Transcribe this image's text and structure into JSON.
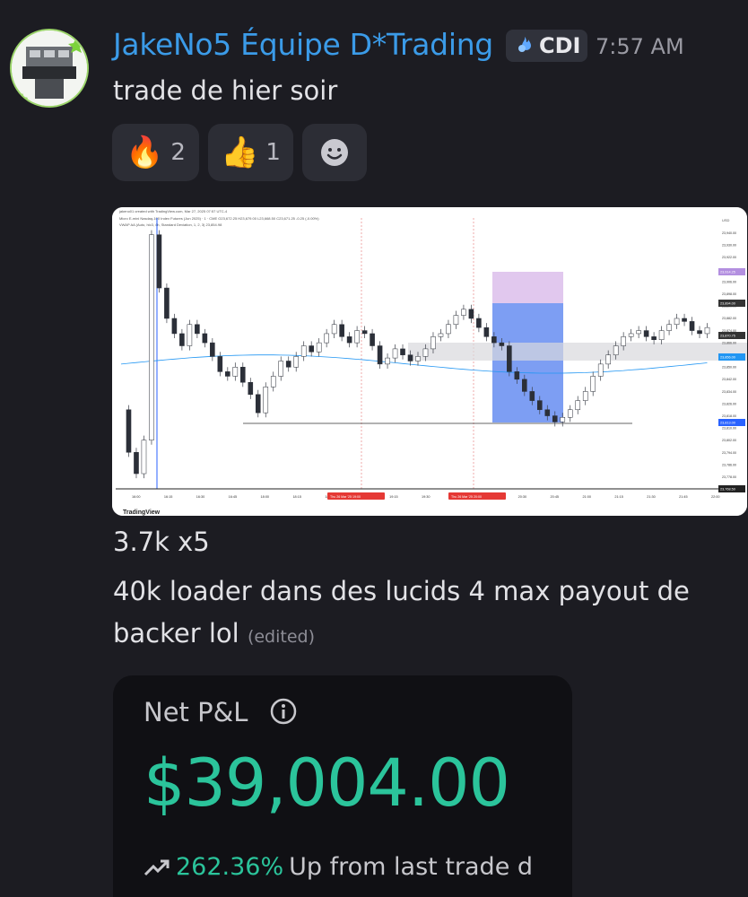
{
  "message": {
    "username": "JakeNo5 Équipe D*Trading",
    "tag": "CDI",
    "timestamp": "7:57 AM",
    "line1": "trade de hier soir",
    "line2": "3.7k x5",
    "line3": "40k loader dans des lucids 4 max payout de",
    "line4": "backer lol",
    "edited": "(edited)"
  },
  "reactions": [
    {
      "emoji": "🔥",
      "count": "2"
    },
    {
      "emoji": "👍",
      "count": "1"
    }
  ],
  "chart": {
    "header1": "jakeno01 created with TradingView.com, Mar 27, 2025 07:57 UTC-4",
    "header2": "Micro E-mini Nasdaq-100 Index Futures (Jun 2025) · 1 · CME  O23,672.25 H23,679.00 L23,668.50 C23,671.25 -0.25 (-0.00%)",
    "header3": "VWAP AA (Auto, hlc3, 4h, Standard Deviation, 1, 2, 3)  23,854.98",
    "currency": "USD",
    "watermark": "TradingView",
    "date_badge_1": "Thu 26 Mar '25  19:00",
    "date_badge_2": "Thu 26 Mar '25  20:00",
    "price_badges": {
      "top": "23,914.25",
      "entry": "23,894.00",
      "mid": "23,870.75",
      "vwap": "23,856.00",
      "target": "23,813.00",
      "last": "23,768.50"
    }
  },
  "chart_data": {
    "type": "candlestick",
    "x_ticks": [
      "16:00",
      "16:15",
      "16:30",
      "16:45",
      "18:00",
      "18:15",
      "18:30",
      "18:45",
      "19:15",
      "19:30",
      "19:45",
      "20:15",
      "20:30",
      "20:45",
      "21:00",
      "21:15",
      "21:30",
      "21:45",
      "22:00"
    ],
    "y_ticks": [
      "23,940.00",
      "23,930.00",
      "23,922.00",
      "23,914.00",
      "23,906.00",
      "23,898.00",
      "23,890.00",
      "23,882.00",
      "23,874.00",
      "23,866.00",
      "23,858.00",
      "23,850.00",
      "23,842.00",
      "23,834.00",
      "23,826.00",
      "23,818.00",
      "23,810.00",
      "23,802.00",
      "23,794.00",
      "23,786.00",
      "23,778.00"
    ],
    "ylim": [
      23768,
      23946
    ],
    "series": [
      {
        "values": [
          23820,
          23792,
          23778,
          23800,
          23935,
          23900,
          23880,
          23870,
          23862,
          23876,
          23870,
          23864,
          23855,
          23845,
          23842,
          23848,
          23838,
          23830,
          23818,
          23835,
          23842,
          23852,
          23848,
          23855,
          23862,
          23858,
          23864,
          23870,
          23876,
          23868,
          23864,
          23872,
          23870,
          23862,
          23850,
          23854,
          23860,
          23856,
          23852,
          23855,
          23860,
          23868,
          23870,
          23876,
          23882,
          23886,
          23880,
          23874,
          23868,
          23864,
          23862,
          23845,
          23840,
          23832,
          23826,
          23820,
          23816,
          23812,
          23815,
          23820,
          23826,
          23832,
          23842,
          23850,
          23856,
          23862,
          23868,
          23870,
          23872,
          23868,
          23866,
          23872,
          23876,
          23880,
          23878,
          23872,
          23870,
          23874
        ]
      }
    ]
  },
  "pnl": {
    "label": "Net P&L",
    "value": "$39,004.00",
    "change": "262.36%",
    "change_desc": "Up from last trade d",
    "up_color": "#2bc49b"
  }
}
